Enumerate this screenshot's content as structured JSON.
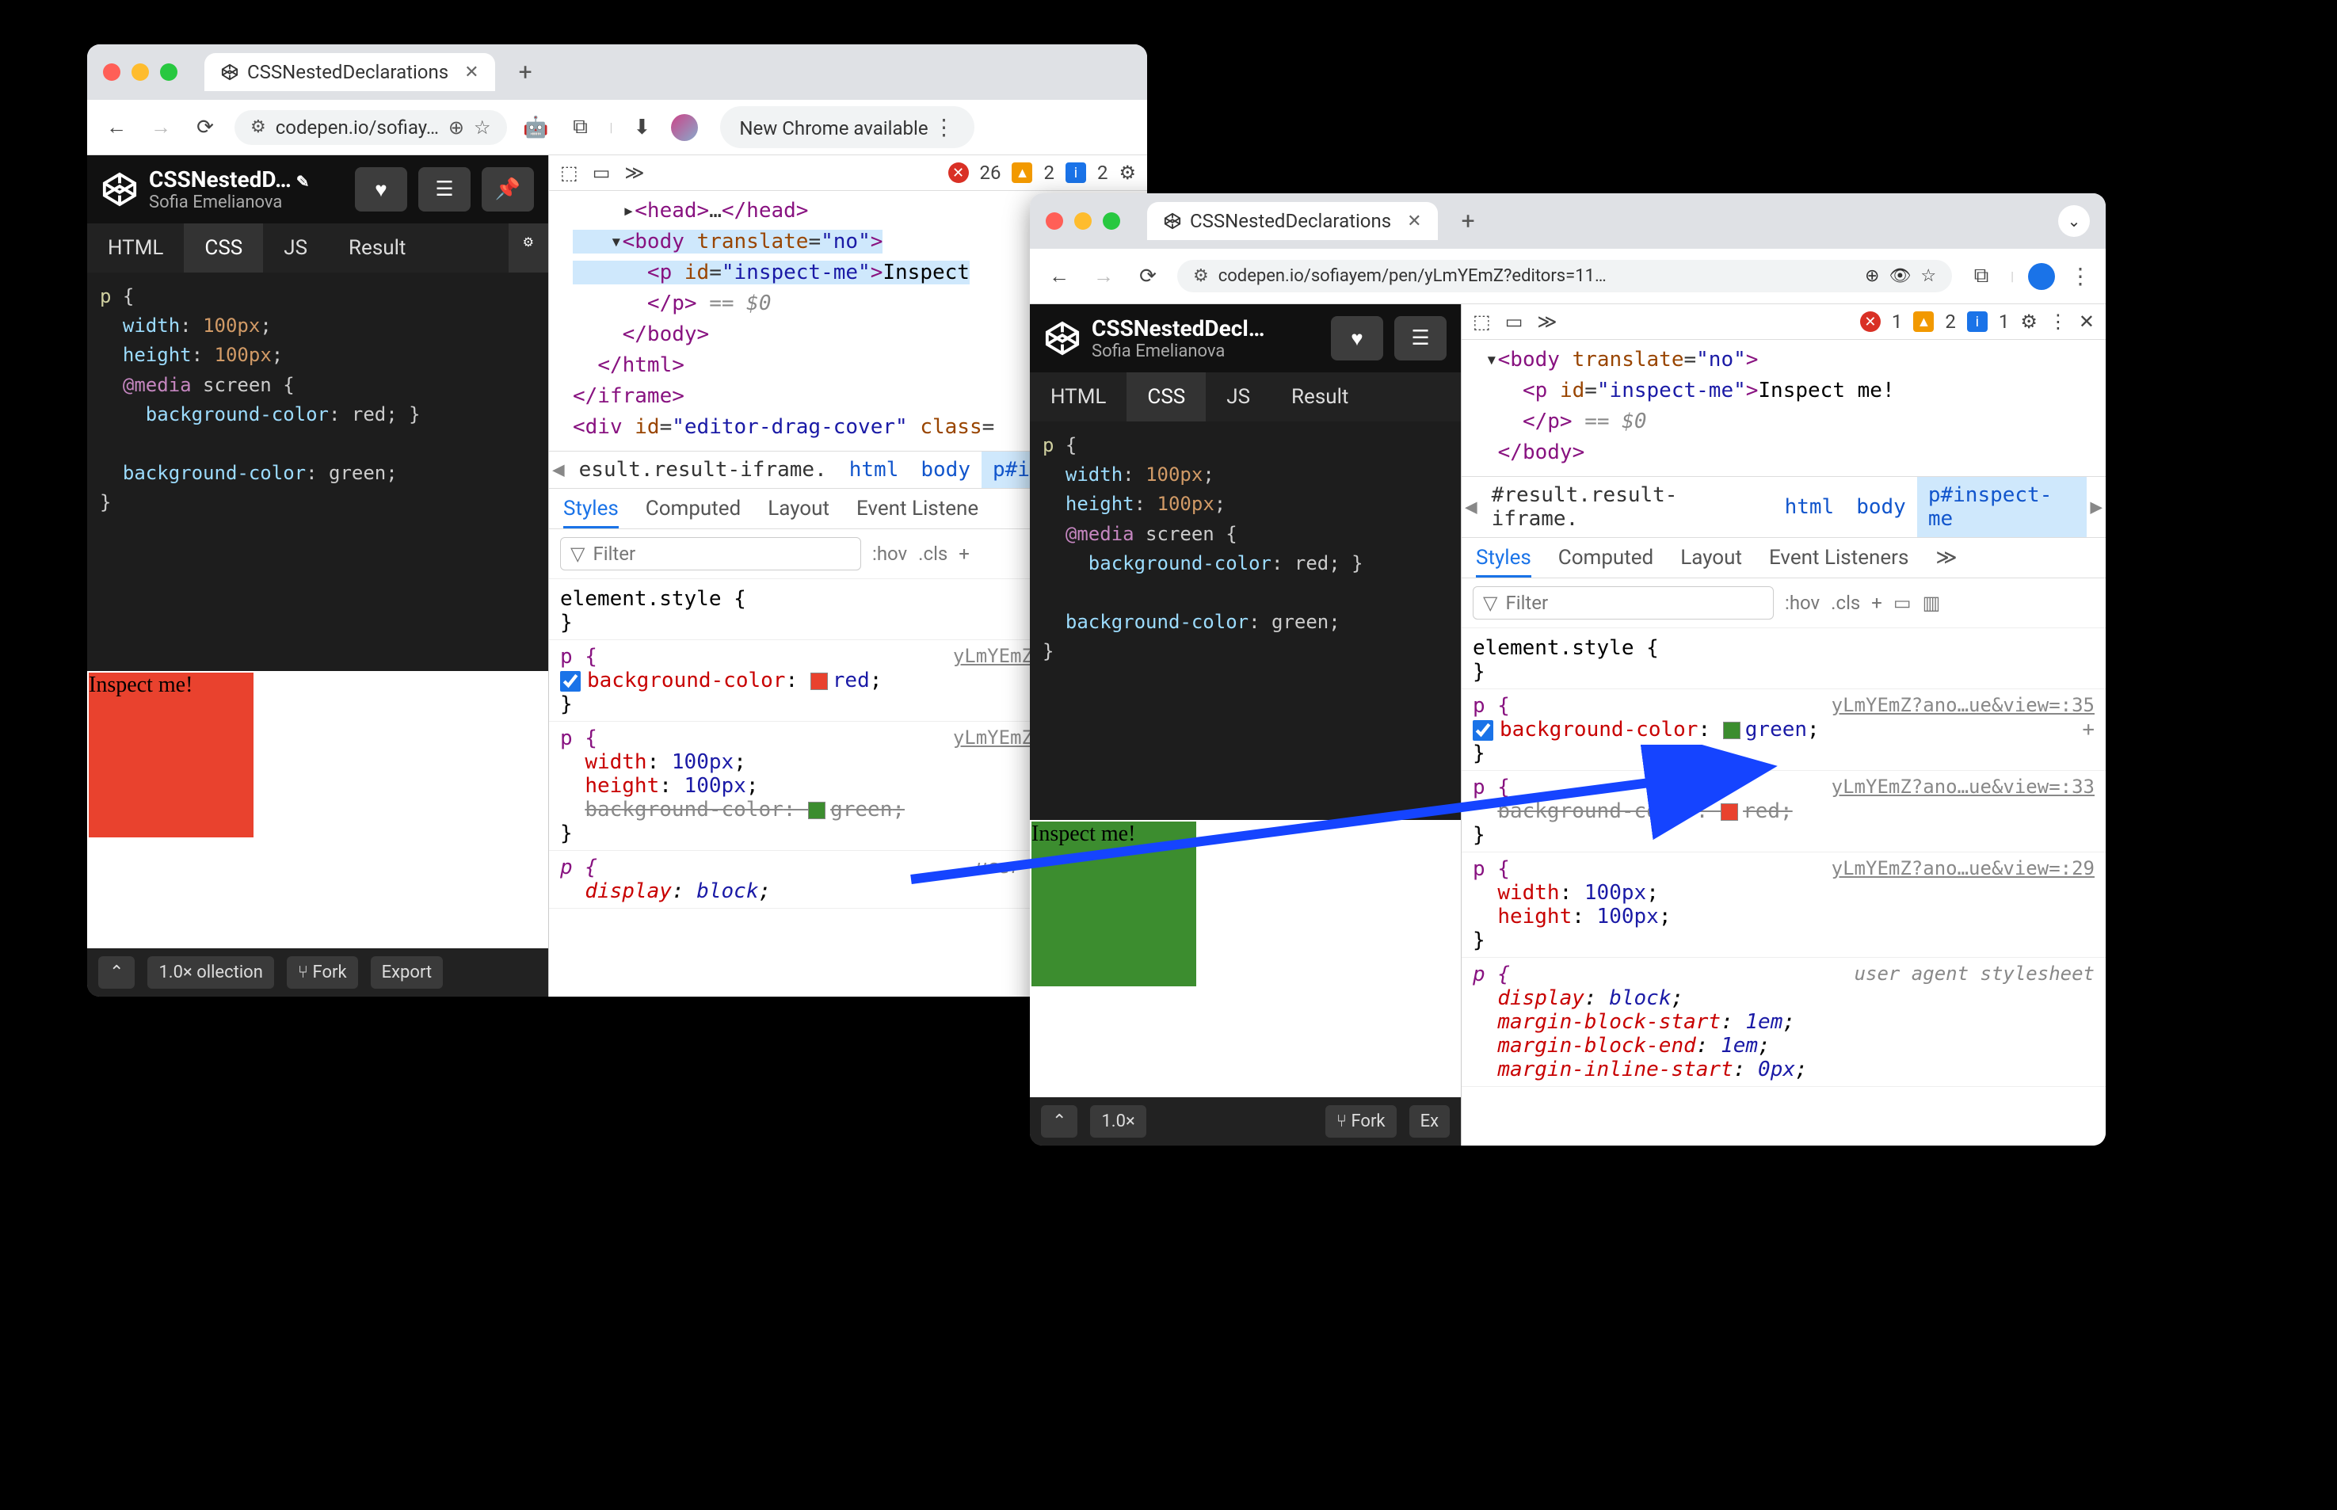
{
  "win1": {
    "tab": {
      "title": "CSSNestedDeclarations"
    },
    "url_short": "codepen.io/sofiay…",
    "new_chrome": "New Chrome available",
    "codepen": {
      "title": "CSSNestedD…",
      "author": "Sofia Emelianova",
      "tabs": {
        "html": "HTML",
        "css": "CSS",
        "js": "JS",
        "result": "Result"
      },
      "css_code": "p {\n  width: 100px;\n  height: 100px;\n  @media screen {\n    background-color: red; }\n\n  background-color: green;\n}",
      "preview_text": "Inspect me!",
      "footer": {
        "zoom": "1.0×",
        "coll": "ollection",
        "fork": "Fork",
        "export": "Export"
      }
    },
    "devtools": {
      "counts": {
        "errors": "26",
        "warnings": "2",
        "info": "2"
      },
      "dom_lines": [
        "    ▸<head>…</head>",
        "   ▾<body translate=\"no\">",
        "      <p id=\"inspect-me\">Inspect",
        "      </p> == $0",
        "    </body>",
        "  </html>",
        "</iframe>",
        "<div id=\"editor-drag-cover\" class="
      ],
      "crumb": {
        "result": "esult.result-iframe.",
        "html": "html",
        "body": "body",
        "p": "p#insp"
      },
      "subtabs": {
        "styles": "Styles",
        "computed": "Computed",
        "layout": "Layout",
        "listeners": "Event Listene"
      },
      "filter": "Filter",
      "hov": ":hov",
      "cls": ".cls",
      "rules": {
        "element_style": "element.style {",
        "src1": "yLmYEmZ?noc…ue&v",
        "r1": {
          "sel": "p {",
          "prop": "background-color",
          "val": "red"
        },
        "src2": "yLmYEmZ?noc…ue&v",
        "r2": {
          "sel": "p {",
          "w": "width",
          "wv": "100px",
          "h": "height",
          "hv": "100px",
          "bg": "background-color",
          "bgv": "green"
        },
        "ua_sel": "p {",
        "ua_src": "user agent sty",
        "ua_disp": "display",
        "ua_dispv": "block"
      }
    }
  },
  "win2": {
    "tab": {
      "title": "CSSNestedDeclarations"
    },
    "url_full": "codepen.io/sofiayem/pen/yLmYEmZ?editors=11…",
    "codepen": {
      "title": "CSSNestedDecl…",
      "author": "Sofia Emelianova",
      "tabs": {
        "html": "HTML",
        "css": "CSS",
        "js": "JS",
        "result": "Result"
      },
      "css_code": "p {\n  width: 100px;\n  height: 100px;\n  @media screen {\n    background-color: red; }\n\n  background-color: green;\n}",
      "preview_text": "Inspect me!",
      "footer": {
        "zoom": "1.0×",
        "fork": "Fork",
        "export": "Ex"
      }
    },
    "devtools": {
      "counts": {
        "errors": "1",
        "warnings": "2",
        "info": "1"
      },
      "dom_lines": [
        "▾<body translate=\"no\">",
        "   <p id=\"inspect-me\">Inspect me!",
        "   </p> == $0",
        " </body>"
      ],
      "crumb": {
        "result": "#result.result-iframe.",
        "html": "html",
        "body": "body",
        "p": "p#inspect-me"
      },
      "subtabs": {
        "styles": "Styles",
        "computed": "Computed",
        "layout": "Layout",
        "listeners": "Event Listeners",
        "more": "≫"
      },
      "filter": "Filter",
      "hov": ":hov",
      "cls": ".cls",
      "rules": {
        "element_style": "element.style {",
        "src1": "yLmYEmZ?ano…ue&view=:35",
        "r1": {
          "sel": "p {",
          "prop": "background-color",
          "val": "green"
        },
        "src2": "yLmYEmZ?ano…ue&view=:33",
        "r2": {
          "sel": "p {",
          "bg": "background-color",
          "bgv": "red"
        },
        "src3": "yLmYEmZ?ano…ue&view=:29",
        "r3": {
          "sel": "p {",
          "w": "width",
          "wv": "100px",
          "h": "height",
          "hv": "100px"
        },
        "ua_sel": "p {",
        "ua_src": "user agent stylesheet",
        "ua": {
          "disp": "display",
          "dispv": "block",
          "mbs": "margin-block-start",
          "mbsv": "1em",
          "mbe": "margin-block-end",
          "mbev": "1em",
          "mis": "margin-inline-start",
          "misv": "0px"
        }
      }
    }
  }
}
